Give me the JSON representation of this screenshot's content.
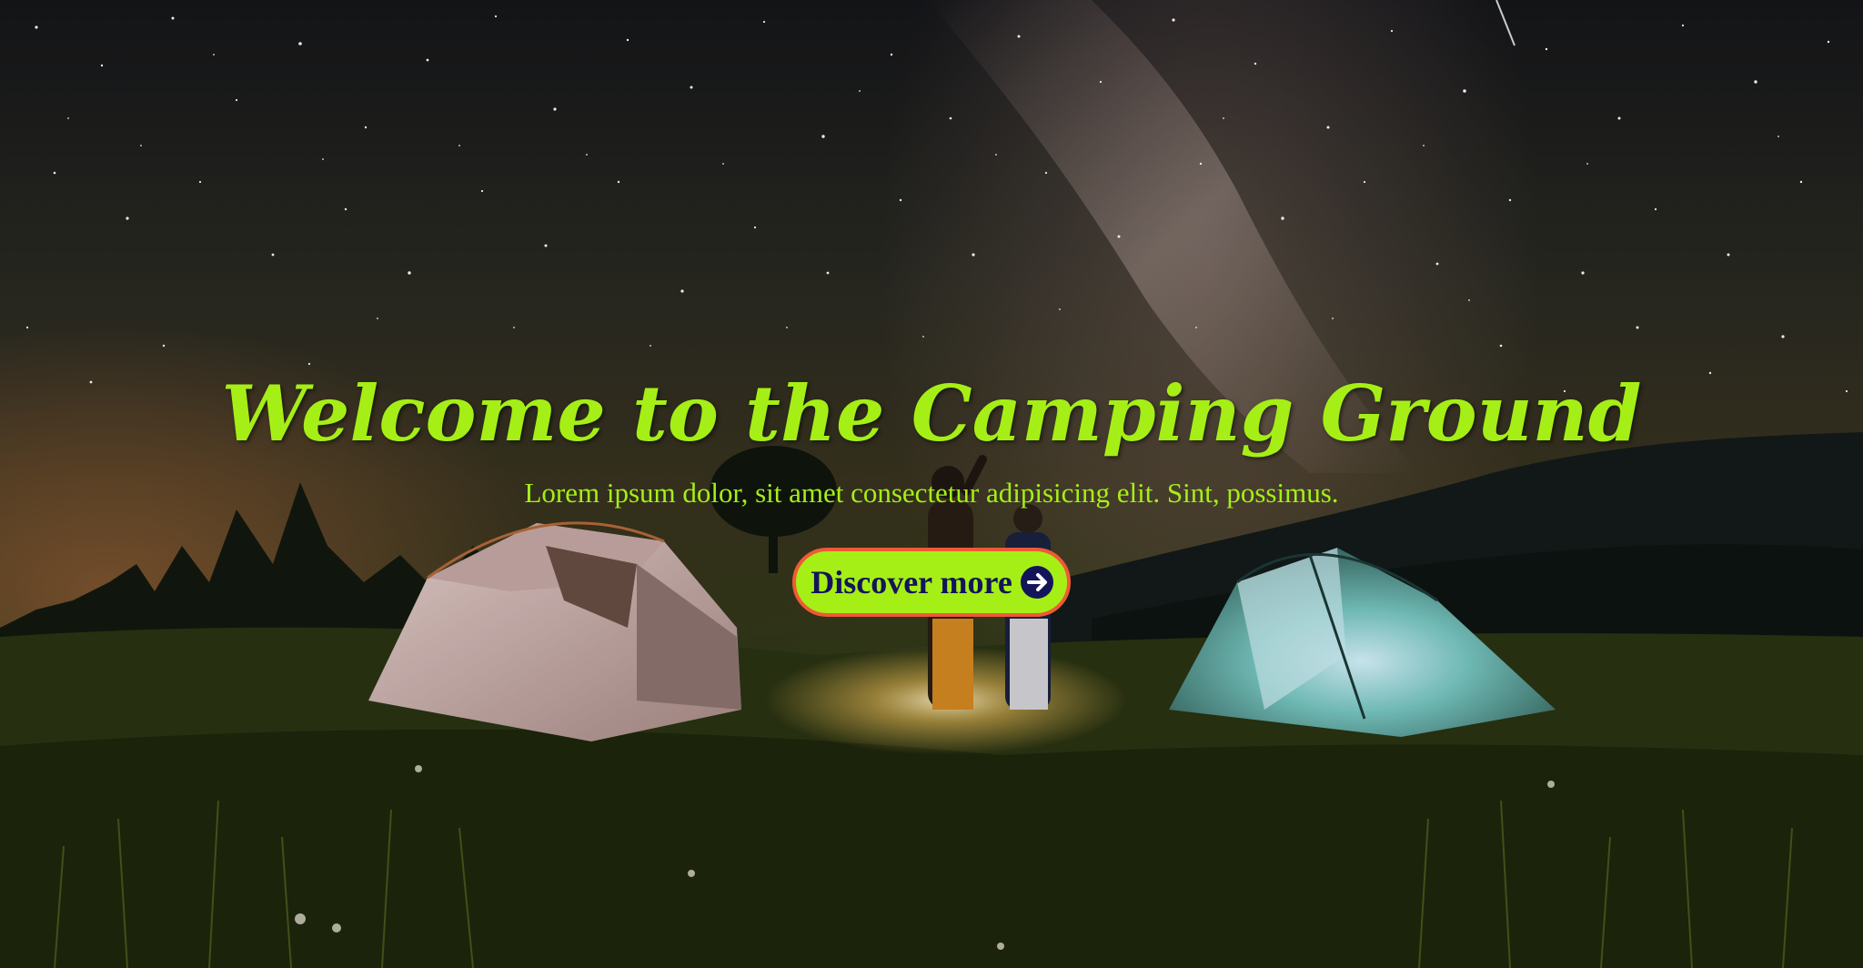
{
  "hero": {
    "title": "Welcome to the Camping Ground",
    "subtitle": "Lorem ipsum dolor, sit amet consectetur adipisicing elit. Sint, possimus.",
    "cta_label": "Discover more",
    "cta_icon": "arrow-right-circle-icon"
  },
  "colors": {
    "accent": "#a5ef16",
    "cta_border": "#ef5a35",
    "cta_text": "#14145a"
  },
  "background": {
    "description_icon": "night-camping-scene"
  }
}
